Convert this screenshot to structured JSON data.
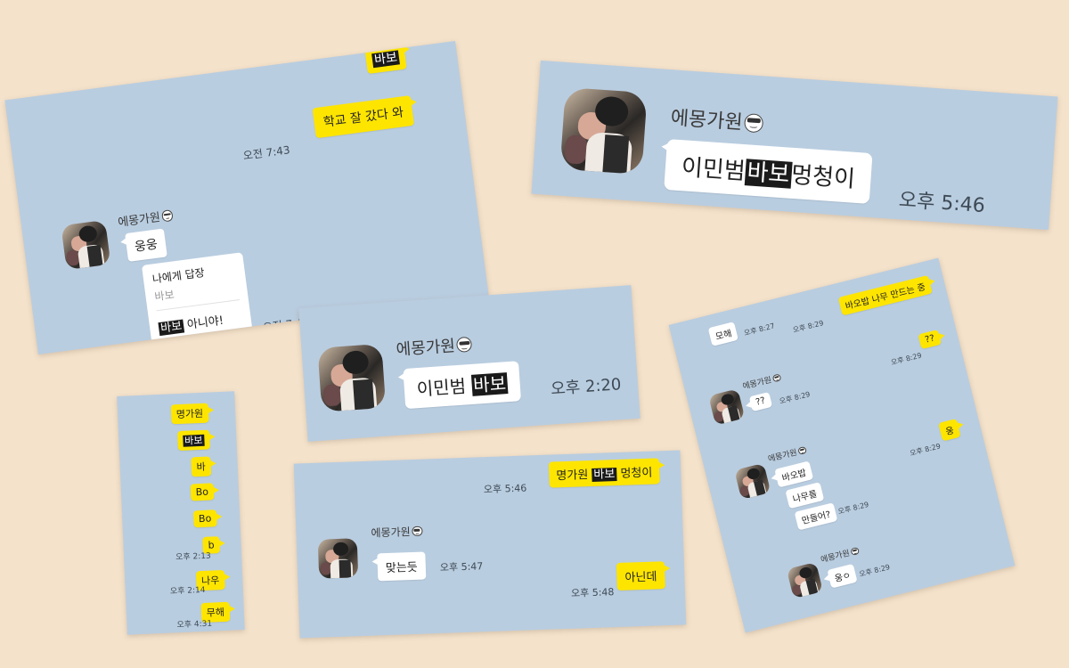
{
  "colors": {
    "background": "#f4e2cb",
    "chat_bg": "#b9cde0",
    "my_bubble": "#fee500",
    "other_bubble": "#ffffff",
    "highlight": "#1a1a1a"
  },
  "icons": {
    "avatar": "profile-photo",
    "name_emoji": "sunglasses-emoji"
  },
  "card1": {
    "msg_babo": "바보",
    "msg_school": "학교 잘 갔다 와",
    "time_morning1": "오전 7:43",
    "sender": "에몽가원",
    "msg_ungung": "웅웅",
    "reply_header": "나에게 답장",
    "reply_quote": "바보",
    "reply_hl": "바보",
    "reply_rest": " 아니야!",
    "time_morning2": "오전 7:43"
  },
  "card2": {
    "sender": "에몽가원",
    "msg_pre": "이민범",
    "msg_hl": "바보",
    "msg_post": "멍청이",
    "time": "오후 5:46"
  },
  "card3": {
    "sender": "에몽가원",
    "msg_pre": "이민범 ",
    "msg_hl": "바보",
    "time": "오후 2:20"
  },
  "card4": {
    "messages": [
      "명가원",
      "바보",
      "바",
      "Bo",
      "Bo",
      "b",
      "나우",
      "무해"
    ],
    "times": [
      "오후 2:13",
      "오후 2:14",
      "오후 4:31"
    ]
  },
  "card5": {
    "msg1_pre": "명가원 ",
    "msg1_hl": "바보",
    "msg1_post": " 멍청이",
    "time1": "오후 5:46",
    "sender": "에몽가원",
    "msg2": "맞는듯",
    "time2": "오후 5:47",
    "msg3": "아닌데",
    "time3": "오후 5:48"
  },
  "card6": {
    "msg_mohae": "모해",
    "time_a": "오후 8:27",
    "msg_babap": "바오밥 나무 만드는 중",
    "time_b": "오후 8:29",
    "sender1": "에몽가원",
    "msg_q_left": "??",
    "time_c": "오후 8:29",
    "msg_q_right": "??",
    "time_d": "오후 8:29",
    "sender2": "에몽가원",
    "msg_l1": "바오밥",
    "msg_l2": "나무를",
    "msg_l3": "만들어?",
    "time_e": "오후 8:29",
    "msg_ung": "웅",
    "time_f": "오후 8:29",
    "sender3": "에몽가원",
    "msg_ungo": "웅ㅇ",
    "time_g": "오후 8:29"
  }
}
